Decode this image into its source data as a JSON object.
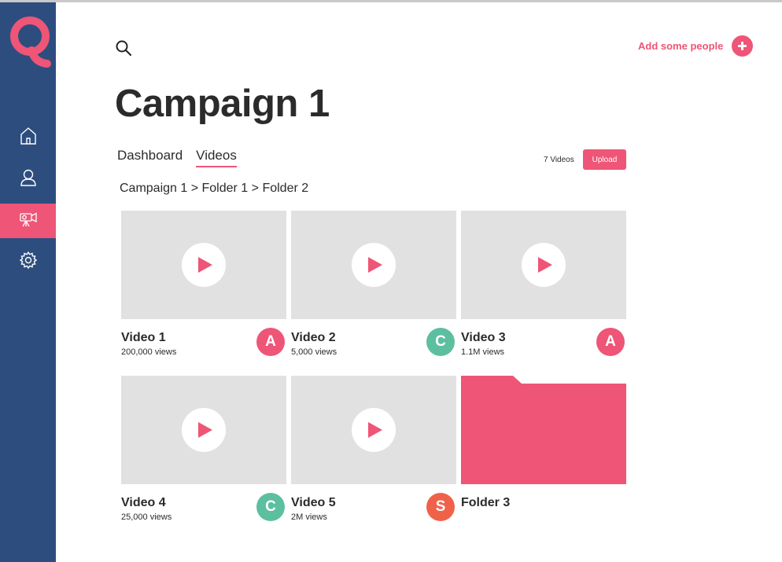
{
  "colors": {
    "sidebar": "#2d4d7f",
    "accent": "#ee5577",
    "avatar_green": "#5cbfa0",
    "avatar_orange": "#f0614a",
    "thumbnail": "#e1e1e1"
  },
  "sidebar": {
    "items": [
      {
        "icon": "home-icon"
      },
      {
        "icon": "user-icon"
      },
      {
        "icon": "video-camera-icon",
        "active": true
      },
      {
        "icon": "gear-icon"
      }
    ]
  },
  "header": {
    "search_icon": "search-icon",
    "add_people_label": "Add some people"
  },
  "page": {
    "title": "Campaign 1"
  },
  "tabs": [
    {
      "label": "Dashboard"
    },
    {
      "label": "Videos",
      "active": true
    }
  ],
  "toolbar": {
    "count_label": "7 Videos",
    "upload_label": "Upload"
  },
  "breadcrumb": "Campaign 1 > Folder 1 > Folder 2",
  "videos": [
    {
      "name": "Video 1",
      "views": "200,000 views",
      "avatar": "A",
      "avatar_color": "#ee5577"
    },
    {
      "name": "Video 2",
      "views": "5,000 views",
      "avatar": "C",
      "avatar_color": "#5cbfa0"
    },
    {
      "name": "Video 3",
      "views": "1.1M views",
      "avatar": "A",
      "avatar_color": "#ee5577"
    },
    {
      "name": "Video 4",
      "views": "25,000 views",
      "avatar": "C",
      "avatar_color": "#5cbfa0"
    },
    {
      "name": "Video 5",
      "views": "2M views",
      "avatar": "S",
      "avatar_color": "#f0614a"
    }
  ],
  "folder": {
    "name": "Folder 3"
  }
}
